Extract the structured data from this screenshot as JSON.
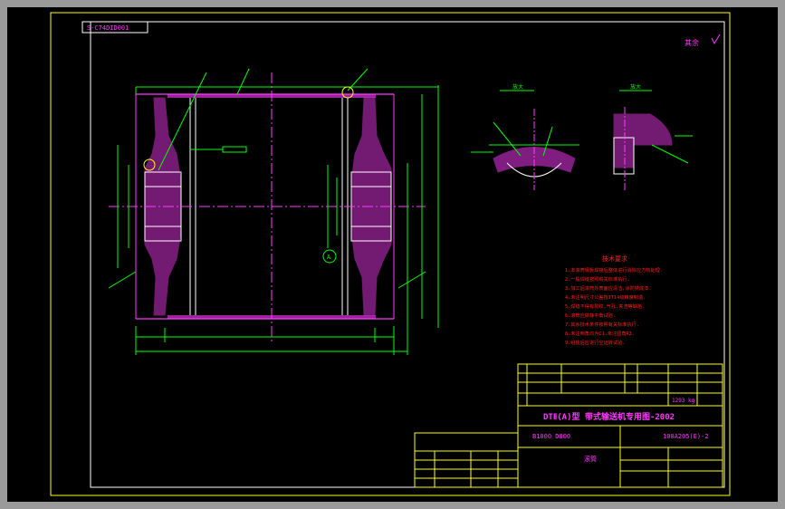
{
  "drawing": {
    "code_tag": "S-C74DID001",
    "surface_mark": "其余",
    "title_line1": "DTⅡ(A)型 带式输送机专用图-2002",
    "model_left": "B1000 D800",
    "model_right": "100A205(E)-2",
    "part_name": "滚筒",
    "weight": "1293 kg",
    "tech_title": "技术要求",
    "tech_lines": [
      "1.本滚筒钢板焊接后整体进行消除应力热处理.",
      "2.一般焊缝按照有关标准执行.",
      "3.加工后滚筒外表面应清洁,涂防锈底漆.",
      "4.未注明尺寸公差按IT14级精度制造.",
      "5.焊缝不得有裂纹,气孔,夹渣等缺陷.",
      "6.滚筒应做静平衡试验.",
      "7.其余技术条件按照有关标准执行.",
      "8.未注倒角均为C1,未注圆角R3.",
      "9.组装后应进行空运转试验."
    ],
    "section_labels": [
      "A",
      "B"
    ],
    "section_view_a": "放大",
    "section_view_b": "放大"
  }
}
